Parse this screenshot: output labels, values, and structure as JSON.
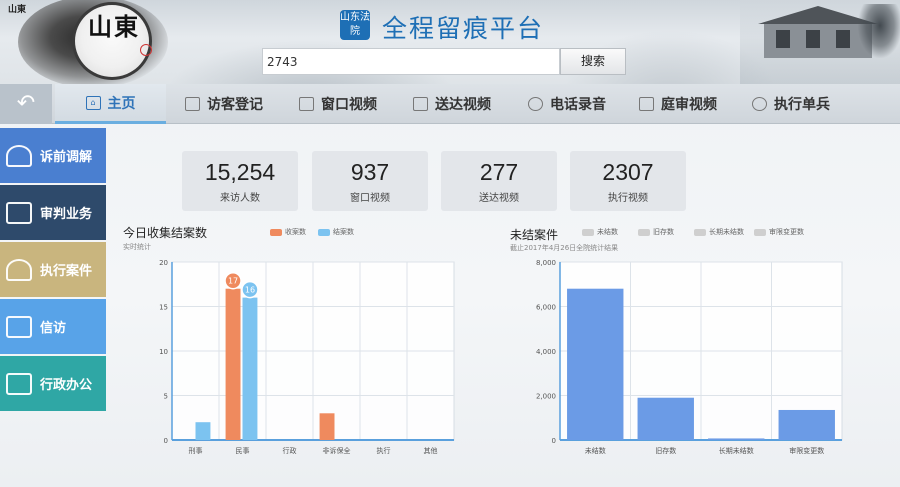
{
  "header": {
    "logo_text": "山東",
    "mini_seal": "山東",
    "title_icon": "山东法院",
    "title": "全程留痕平台",
    "search_value": "2743",
    "search_button": "搜索"
  },
  "nav": {
    "back": "↶",
    "tabs": [
      {
        "label": "主页",
        "icon": "home-icon"
      },
      {
        "label": "访客登记",
        "icon": "visitor-icon"
      },
      {
        "label": "窗口视频",
        "icon": "video-window-icon"
      },
      {
        "label": "送达视频",
        "icon": "calendar-icon"
      },
      {
        "label": "电话录音",
        "icon": "gear-icon"
      },
      {
        "label": "庭审视频",
        "icon": "video-window-icon"
      },
      {
        "label": "执行单兵",
        "icon": "gear-icon"
      }
    ]
  },
  "sidebar": {
    "items": [
      {
        "label": "诉前调解",
        "color": "#4a7fd0",
        "icon": "people-icon"
      },
      {
        "label": "审判业务",
        "color": "#2e4a6b",
        "icon": "gavel-icon"
      },
      {
        "label": "执行案件",
        "color": "#c9b57e",
        "icon": "handshake-icon"
      },
      {
        "label": "信访",
        "color": "#58a3e8",
        "icon": "envelope-icon"
      },
      {
        "label": "行政办公",
        "color": "#2fa7a5",
        "icon": "office-icon"
      }
    ]
  },
  "stats": [
    {
      "value": "15,254",
      "label": "来访人数"
    },
    {
      "value": "937",
      "label": "窗口视频"
    },
    {
      "value": "277",
      "label": "送达视频"
    },
    {
      "value": "2307",
      "label": "执行视频"
    }
  ],
  "chart_data": [
    {
      "type": "bar",
      "title": "今日收集结案数",
      "subtitle": "实时统计",
      "categories": [
        "刑事",
        "民事",
        "行政",
        "非诉保全",
        "执行",
        "其他"
      ],
      "series": [
        {
          "name": "收案数",
          "color": "#ef8a5e",
          "values": [
            0,
            17,
            0,
            3,
            0,
            0
          ]
        },
        {
          "name": "结案数",
          "color": "#7cc3f0",
          "values": [
            2,
            16,
            0,
            0,
            0,
            0
          ]
        }
      ],
      "data_labels": [
        {
          "category": "民事",
          "series": "收案数",
          "text": "17"
        },
        {
          "category": "民事",
          "series": "结案数",
          "text": "16"
        }
      ],
      "ylim": [
        0,
        20
      ],
      "yticks": [
        "0",
        "5",
        "10",
        "15",
        "20"
      ],
      "grid": true,
      "legend": "top"
    },
    {
      "type": "bar",
      "title": "未结案件",
      "subtitle": "截止2017年4月26日全院统计结果",
      "categories": [
        "未结数",
        "旧存数",
        "长期未结数",
        "审限变更数"
      ],
      "values": [
        6800,
        1900,
        70,
        1350
      ],
      "bar_color": "#6b9be6",
      "legend_items": [
        "未结数",
        "旧存数",
        "长期未结数",
        "审限变更数"
      ],
      "ylim": [
        0,
        8000
      ],
      "yticks": [
        "0",
        "2,000",
        "4,000",
        "6,000",
        "8,000"
      ],
      "grid": true,
      "legend": "top"
    }
  ]
}
